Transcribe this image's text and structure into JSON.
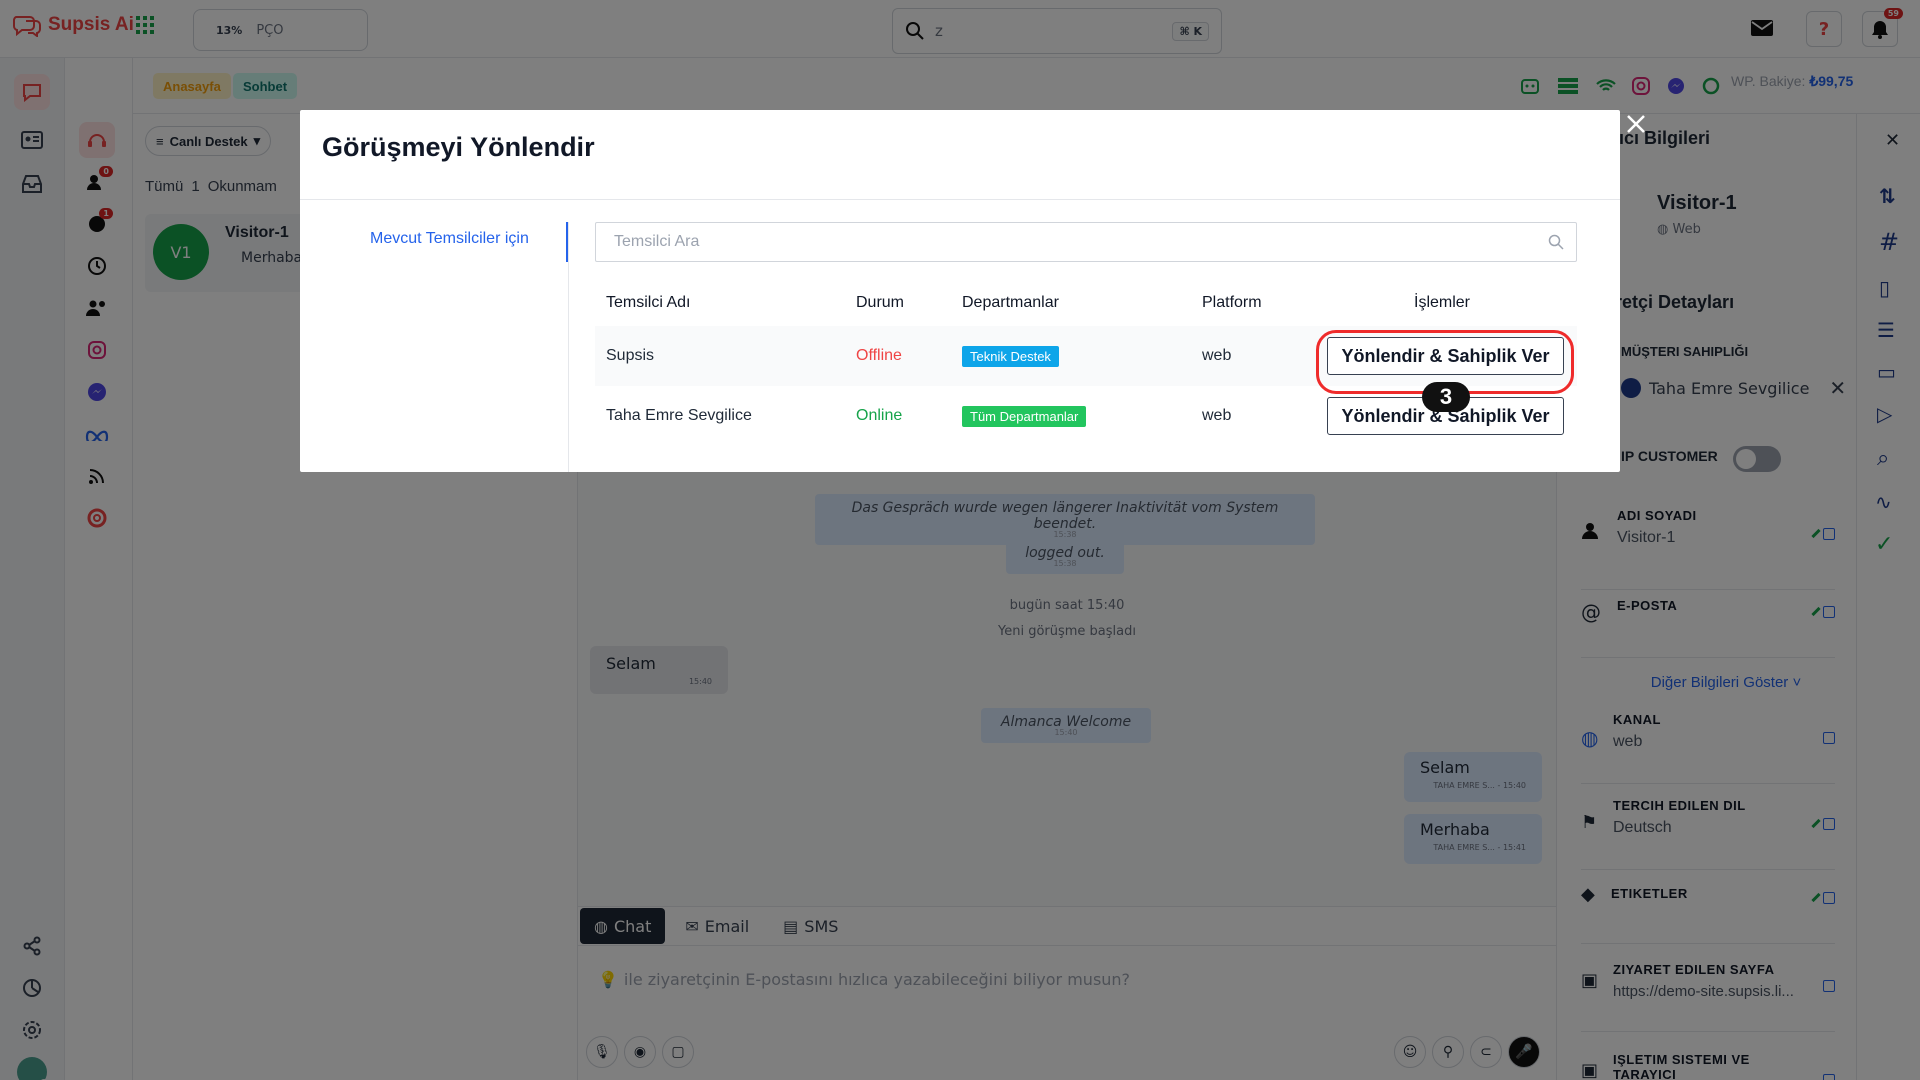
{
  "app": {
    "name": "Supsis Ai",
    "brand_color": "#ef4444"
  },
  "topbar": {
    "progress": {
      "percent_label": "13%",
      "percent": 13,
      "label": "PÇO"
    },
    "search": {
      "query": "z",
      "shortcut": "⌘ K"
    },
    "notifications_count": "59"
  },
  "subbar": {
    "crumbs": [
      {
        "label": "Anasayfa",
        "color": "#f59e0b"
      },
      {
        "label": "Sohbet",
        "color": "#0f766e"
      }
    ],
    "wp_label": "WP. Bakiye:",
    "wp_value": "₺99,75"
  },
  "rail2_badges": {
    "queue": "0",
    "missed": "1"
  },
  "convlist": {
    "filter_label": "Canlı Destek",
    "tabs": [
      "Tümü",
      "1",
      "Okunmam"
    ],
    "item": {
      "initials": "V1",
      "name": "Visitor-1",
      "preview": "Merhaba"
    }
  },
  "chat": {
    "system_messages": [
      {
        "text": "Das Gespräch wurde wegen längerer Inaktivität vom System beendet.",
        "time": "15:38"
      },
      {
        "text": "logged out.",
        "time": "15:38"
      }
    ],
    "day_divider": "bugün saat 15:40",
    "new_conv": "Yeni görüşme başladı",
    "incoming": {
      "text": "Selam",
      "time": "15:40"
    },
    "welcome": {
      "text": "Almanca Welcome",
      "time": "15:40"
    },
    "outgoing": [
      {
        "text": "Selam",
        "meta": "TAHA EMRE S... - 15:40"
      },
      {
        "text": "Merhaba",
        "meta": "TAHA EMRE S... - 15:41"
      }
    ],
    "channels": [
      "Chat",
      "Email",
      "SMS"
    ],
    "composer_placeholder": "ile ziyaretçinin E-postasını hızlıca yazabileceğini biliyor musun?"
  },
  "right_panel": {
    "title": "ıcı Bilgileri",
    "visitor_name": "Visitor-1",
    "visitor_channel": "Web",
    "section": "retçi Detayları",
    "ownership_label": "MÜŞTERI SAHIPLIĞI",
    "ownership_value": "Taha Emre Sevgilice",
    "vip_label": "IP CUSTOMER",
    "fields": [
      {
        "title": "ADI SOYADI",
        "value": "Visitor-1"
      },
      {
        "title": "E-POSTA",
        "value": ""
      },
      {
        "title": "KANAL",
        "value": "web"
      },
      {
        "title": "TERCIH EDILEN DIL",
        "value": "Deutsch"
      },
      {
        "title": "ETIKETLER",
        "value": ""
      },
      {
        "title": "ZIYARET EDILEN SAYFA",
        "value": "https://demo-site.supsis.li..."
      },
      {
        "title": "IŞLETIM SISTEMI VE TARAYICI",
        "value": ""
      }
    ],
    "more_link": "Diğer Bilgileri Göster"
  },
  "modal": {
    "title": "Görüşmeyi Yönlendir",
    "side_tab": "Mevcut Temsilciler için",
    "search_placeholder": "Temsilci Ara",
    "columns": [
      "Temsilci Adı",
      "Durum",
      "Departmanlar",
      "Platform",
      "İşlemler"
    ],
    "rows": [
      {
        "name": "Supsis",
        "status": "Offline",
        "status_color": "#ef4444",
        "dept": "Teknik Destek",
        "dept_color": "#0ea5e9",
        "platform": "web",
        "action": "Yönlendir & Sahiplik Ver"
      },
      {
        "name": "Taha Emre Sevgilice",
        "status": "Online",
        "status_color": "#16a34a",
        "dept": "Tüm Departmanlar",
        "dept_color": "#22c55e",
        "platform": "web",
        "action": "Yönlendir & Sahiplik Ver"
      }
    ],
    "step_badge": "3"
  }
}
